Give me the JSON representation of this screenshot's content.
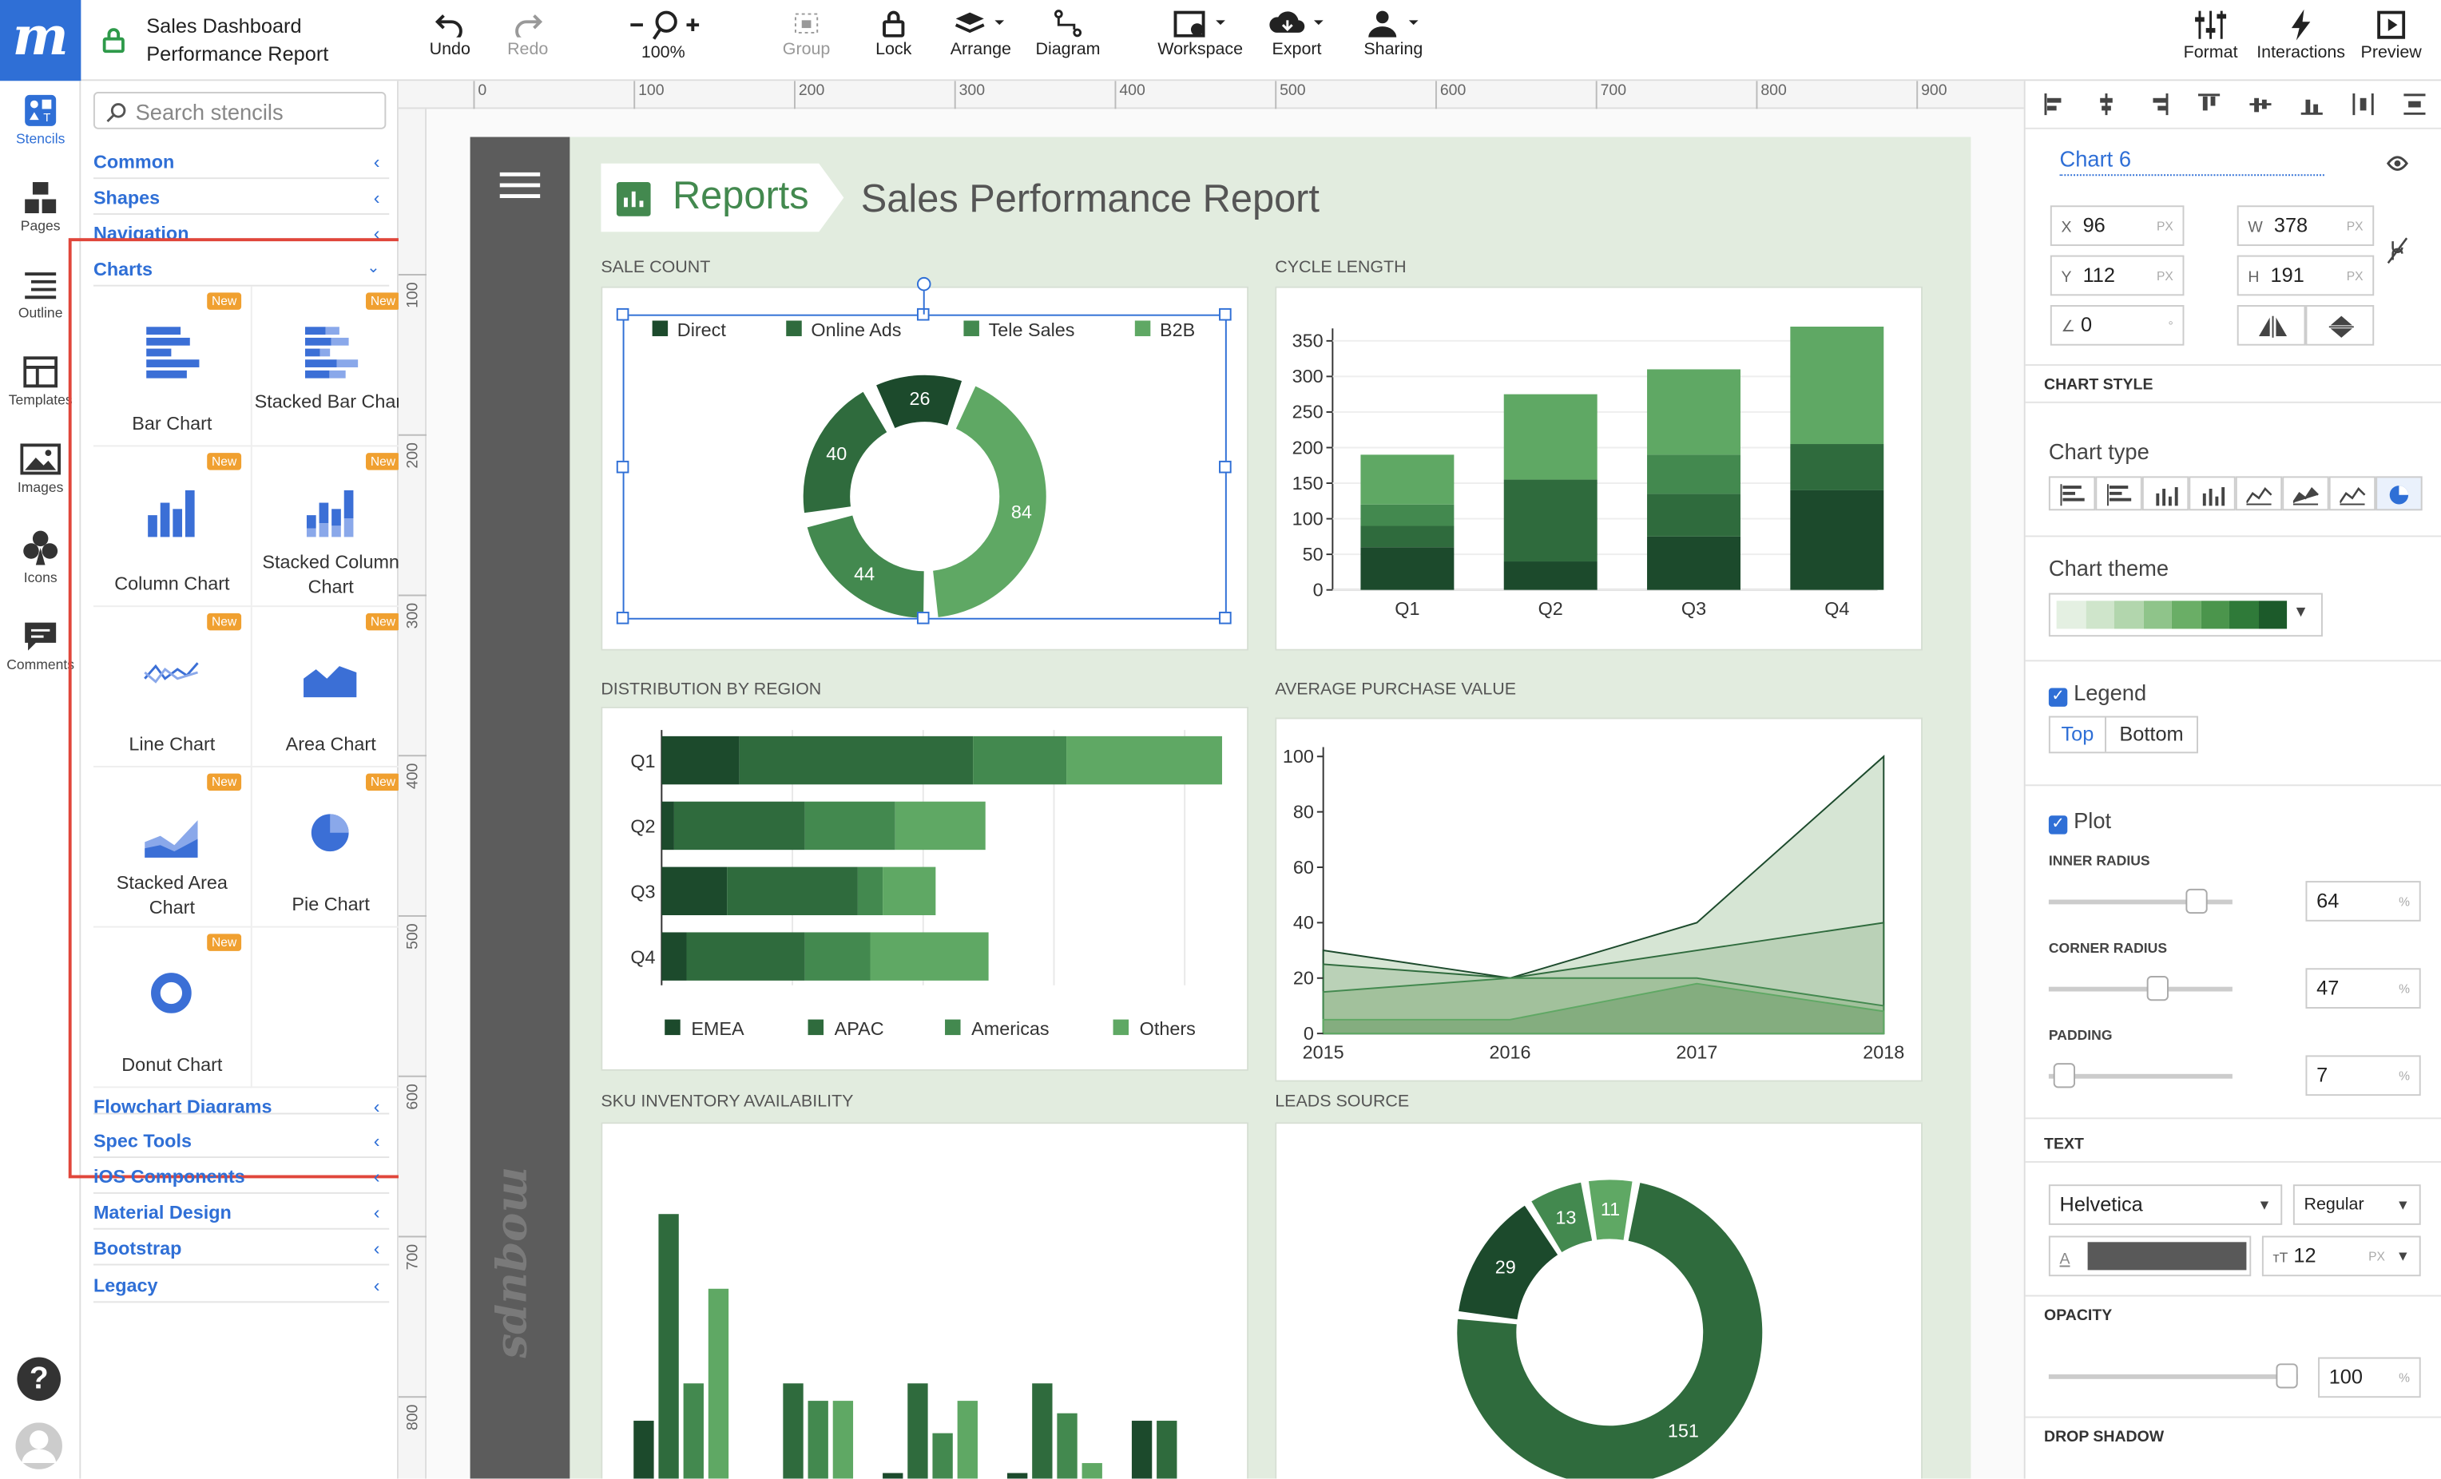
{
  "doc": {
    "title": "Sales Dashboard",
    "subtitle": "Performance Report"
  },
  "toolbar": {
    "undo": "Undo",
    "redo": "Redo",
    "zoom": "100%",
    "group": "Group",
    "lock": "Lock",
    "arrange": "Arrange",
    "diagram": "Diagram",
    "workspace": "Workspace",
    "export": "Export",
    "sharing": "Sharing",
    "format": "Format",
    "interactions": "Interactions",
    "preview": "Preview"
  },
  "rail": [
    "Stencils",
    "Pages",
    "Outline",
    "Templates",
    "Images",
    "Icons",
    "Comments"
  ],
  "stencils": {
    "search_placeholder": "Search stencils",
    "categories_top": [
      "Common",
      "Shapes",
      "Navigation"
    ],
    "charts_label": "Charts",
    "new_badge": "New",
    "items": [
      "Bar Chart",
      "Stacked Bar Chart",
      "Column Chart",
      "Stacked Column Chart",
      "Line Chart",
      "Area Chart",
      "Stacked Area Chart",
      "Pie Chart",
      "Donut Chart"
    ],
    "categories_bottom": [
      "Flowchart Diagrams",
      "Spec Tools",
      "iOS Components",
      "Material Design",
      "Bootstrap",
      "Legacy"
    ]
  },
  "ruler": {
    "h": [
      "0",
      "100",
      "200",
      "300",
      "400",
      "500",
      "600",
      "700",
      "800",
      "900"
    ],
    "v": [
      "100",
      "200",
      "300",
      "400",
      "500",
      "600",
      "700",
      "800"
    ]
  },
  "report": {
    "badge": "Reports",
    "title": "Sales Performance Report",
    "brand": "moqups"
  },
  "sections": {
    "sale_count": "SALE COUNT",
    "cycle_length": "CYCLE LENGTH",
    "distribution": "DISTRIBUTION BY REGION",
    "avg_purchase": "AVERAGE PURCHASE VALUE",
    "sku": "SKU INVENTORY AVAILABILITY",
    "leads": "LEADS SOURCE"
  },
  "colors": {
    "c1": "#1c4a2c",
    "c2": "#2f6b3d",
    "c3": "#43894f",
    "c4": "#5fa864",
    "accent": "#2f6fd6"
  },
  "chart_data": [
    {
      "type": "pie",
      "name": "sale_count",
      "donut": true,
      "legend": [
        "Direct",
        "Online Ads",
        "Tele Sales",
        "B2B"
      ],
      "values": [
        26,
        84,
        44,
        40
      ]
    },
    {
      "type": "bar",
      "name": "cycle_length",
      "stacked": true,
      "categories": [
        "Q1",
        "Q2",
        "Q3",
        "Q4"
      ],
      "yticks": [
        "0",
        "50",
        "100",
        "150",
        "200",
        "250",
        "300",
        "350"
      ],
      "ylim": [
        0,
        350
      ],
      "series": [
        {
          "values": [
            60,
            40,
            75,
            140
          ]
        },
        {
          "values": [
            30,
            115,
            60,
            65
          ]
        },
        {
          "values": [
            30,
            0,
            55,
            0
          ]
        },
        {
          "values": [
            70,
            120,
            120,
            165
          ]
        }
      ]
    },
    {
      "type": "bar",
      "name": "distribution_by_region",
      "orientation": "horizontal",
      "stacked": true,
      "categories": [
        "Q1",
        "Q2",
        "Q3",
        "Q4"
      ],
      "legend": [
        "EMEA",
        "APAC",
        "Americas",
        "Others"
      ],
      "series": [
        {
          "name": "EMEA",
          "values": [
            50,
            8,
            42,
            16
          ]
        },
        {
          "name": "APAC",
          "values": [
            150,
            84,
            84,
            76
          ]
        },
        {
          "name": "Americas",
          "values": [
            60,
            58,
            16,
            42
          ]
        },
        {
          "name": "Others",
          "values": [
            100,
            58,
            34,
            76
          ]
        }
      ]
    },
    {
      "type": "area",
      "name": "average_purchase_value",
      "x": [
        "2015",
        "2016",
        "2017",
        "2018"
      ],
      "yticks": [
        "0",
        "20",
        "40",
        "60",
        "80",
        "100"
      ],
      "ylim": [
        0,
        100
      ],
      "series": [
        {
          "values": [
            30,
            20,
            40,
            100
          ]
        },
        {
          "values": [
            25,
            20,
            30,
            40
          ]
        },
        {
          "values": [
            15,
            20,
            20,
            10
          ]
        },
        {
          "values": [
            5,
            5,
            18,
            8
          ]
        }
      ]
    },
    {
      "type": "bar",
      "name": "sku_inventory_availability",
      "series": [
        {
          "values": [
            37,
            2,
            16,
            16,
            37
          ]
        },
        {
          "values": [
            120,
            52,
            52,
            52,
            37
          ]
        },
        {
          "values": [
            52,
            45,
            32,
            40,
            0
          ]
        },
        {
          "values": [
            90,
            45,
            45,
            20,
            0
          ]
        }
      ]
    },
    {
      "type": "pie",
      "name": "leads_source",
      "donut": true,
      "values": [
        151,
        29,
        13,
        11
      ]
    }
  ],
  "props": {
    "name": "Chart 6",
    "x": "96",
    "w": "378",
    "y": "112",
    "h": "191",
    "angle": "0",
    "unit": "PX",
    "deg": "°",
    "chart_style": "CHART STYLE",
    "chart_type": "Chart type",
    "chart_theme": "Chart theme",
    "legend": "Legend",
    "legend_top": "Top",
    "legend_bottom": "Bottom",
    "plot": "Plot",
    "inner_radius_label": "INNER RADIUS",
    "inner_radius": "64",
    "corner_radius_label": "CORNER RADIUS",
    "corner_radius": "47",
    "padding_label": "PADDING",
    "padding": "7",
    "pct": "%",
    "text_label": "TEXT",
    "font": "Helvetica",
    "weight": "Regular",
    "font_size": "12",
    "opacity_label": "OPACITY",
    "opacity": "100",
    "drop_shadow": "DROP SHADOW"
  }
}
